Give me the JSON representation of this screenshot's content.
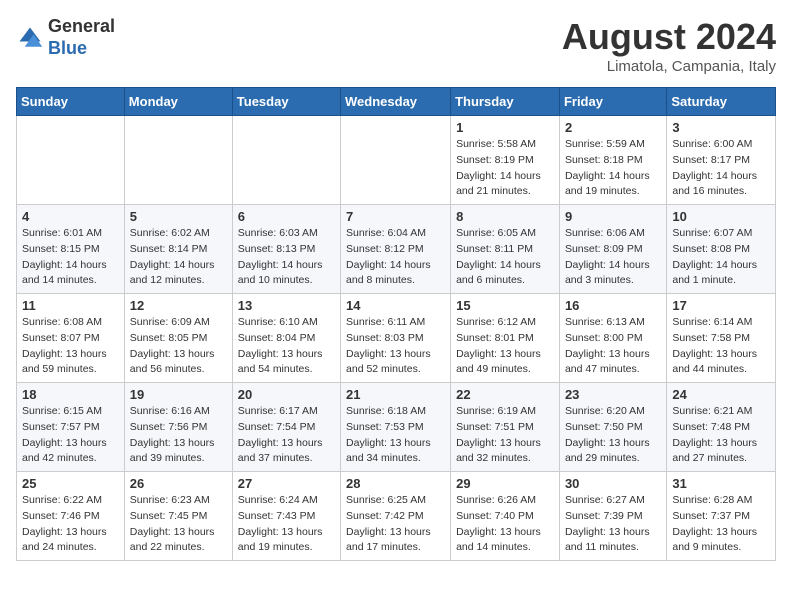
{
  "header": {
    "logo_general": "General",
    "logo_blue": "Blue",
    "month_title": "August 2024",
    "location": "Limatola, Campania, Italy"
  },
  "days_of_week": [
    "Sunday",
    "Monday",
    "Tuesday",
    "Wednesday",
    "Thursday",
    "Friday",
    "Saturday"
  ],
  "weeks": [
    [
      {
        "day": "",
        "info": ""
      },
      {
        "day": "",
        "info": ""
      },
      {
        "day": "",
        "info": ""
      },
      {
        "day": "",
        "info": ""
      },
      {
        "day": "1",
        "info": "Sunrise: 5:58 AM\nSunset: 8:19 PM\nDaylight: 14 hours\nand 21 minutes."
      },
      {
        "day": "2",
        "info": "Sunrise: 5:59 AM\nSunset: 8:18 PM\nDaylight: 14 hours\nand 19 minutes."
      },
      {
        "day": "3",
        "info": "Sunrise: 6:00 AM\nSunset: 8:17 PM\nDaylight: 14 hours\nand 16 minutes."
      }
    ],
    [
      {
        "day": "4",
        "info": "Sunrise: 6:01 AM\nSunset: 8:15 PM\nDaylight: 14 hours\nand 14 minutes."
      },
      {
        "day": "5",
        "info": "Sunrise: 6:02 AM\nSunset: 8:14 PM\nDaylight: 14 hours\nand 12 minutes."
      },
      {
        "day": "6",
        "info": "Sunrise: 6:03 AM\nSunset: 8:13 PM\nDaylight: 14 hours\nand 10 minutes."
      },
      {
        "day": "7",
        "info": "Sunrise: 6:04 AM\nSunset: 8:12 PM\nDaylight: 14 hours\nand 8 minutes."
      },
      {
        "day": "8",
        "info": "Sunrise: 6:05 AM\nSunset: 8:11 PM\nDaylight: 14 hours\nand 6 minutes."
      },
      {
        "day": "9",
        "info": "Sunrise: 6:06 AM\nSunset: 8:09 PM\nDaylight: 14 hours\nand 3 minutes."
      },
      {
        "day": "10",
        "info": "Sunrise: 6:07 AM\nSunset: 8:08 PM\nDaylight: 14 hours\nand 1 minute."
      }
    ],
    [
      {
        "day": "11",
        "info": "Sunrise: 6:08 AM\nSunset: 8:07 PM\nDaylight: 13 hours\nand 59 minutes."
      },
      {
        "day": "12",
        "info": "Sunrise: 6:09 AM\nSunset: 8:05 PM\nDaylight: 13 hours\nand 56 minutes."
      },
      {
        "day": "13",
        "info": "Sunrise: 6:10 AM\nSunset: 8:04 PM\nDaylight: 13 hours\nand 54 minutes."
      },
      {
        "day": "14",
        "info": "Sunrise: 6:11 AM\nSunset: 8:03 PM\nDaylight: 13 hours\nand 52 minutes."
      },
      {
        "day": "15",
        "info": "Sunrise: 6:12 AM\nSunset: 8:01 PM\nDaylight: 13 hours\nand 49 minutes."
      },
      {
        "day": "16",
        "info": "Sunrise: 6:13 AM\nSunset: 8:00 PM\nDaylight: 13 hours\nand 47 minutes."
      },
      {
        "day": "17",
        "info": "Sunrise: 6:14 AM\nSunset: 7:58 PM\nDaylight: 13 hours\nand 44 minutes."
      }
    ],
    [
      {
        "day": "18",
        "info": "Sunrise: 6:15 AM\nSunset: 7:57 PM\nDaylight: 13 hours\nand 42 minutes."
      },
      {
        "day": "19",
        "info": "Sunrise: 6:16 AM\nSunset: 7:56 PM\nDaylight: 13 hours\nand 39 minutes."
      },
      {
        "day": "20",
        "info": "Sunrise: 6:17 AM\nSunset: 7:54 PM\nDaylight: 13 hours\nand 37 minutes."
      },
      {
        "day": "21",
        "info": "Sunrise: 6:18 AM\nSunset: 7:53 PM\nDaylight: 13 hours\nand 34 minutes."
      },
      {
        "day": "22",
        "info": "Sunrise: 6:19 AM\nSunset: 7:51 PM\nDaylight: 13 hours\nand 32 minutes."
      },
      {
        "day": "23",
        "info": "Sunrise: 6:20 AM\nSunset: 7:50 PM\nDaylight: 13 hours\nand 29 minutes."
      },
      {
        "day": "24",
        "info": "Sunrise: 6:21 AM\nSunset: 7:48 PM\nDaylight: 13 hours\nand 27 minutes."
      }
    ],
    [
      {
        "day": "25",
        "info": "Sunrise: 6:22 AM\nSunset: 7:46 PM\nDaylight: 13 hours\nand 24 minutes."
      },
      {
        "day": "26",
        "info": "Sunrise: 6:23 AM\nSunset: 7:45 PM\nDaylight: 13 hours\nand 22 minutes."
      },
      {
        "day": "27",
        "info": "Sunrise: 6:24 AM\nSunset: 7:43 PM\nDaylight: 13 hours\nand 19 minutes."
      },
      {
        "day": "28",
        "info": "Sunrise: 6:25 AM\nSunset: 7:42 PM\nDaylight: 13 hours\nand 17 minutes."
      },
      {
        "day": "29",
        "info": "Sunrise: 6:26 AM\nSunset: 7:40 PM\nDaylight: 13 hours\nand 14 minutes."
      },
      {
        "day": "30",
        "info": "Sunrise: 6:27 AM\nSunset: 7:39 PM\nDaylight: 13 hours\nand 11 minutes."
      },
      {
        "day": "31",
        "info": "Sunrise: 6:28 AM\nSunset: 7:37 PM\nDaylight: 13 hours\nand 9 minutes."
      }
    ]
  ]
}
